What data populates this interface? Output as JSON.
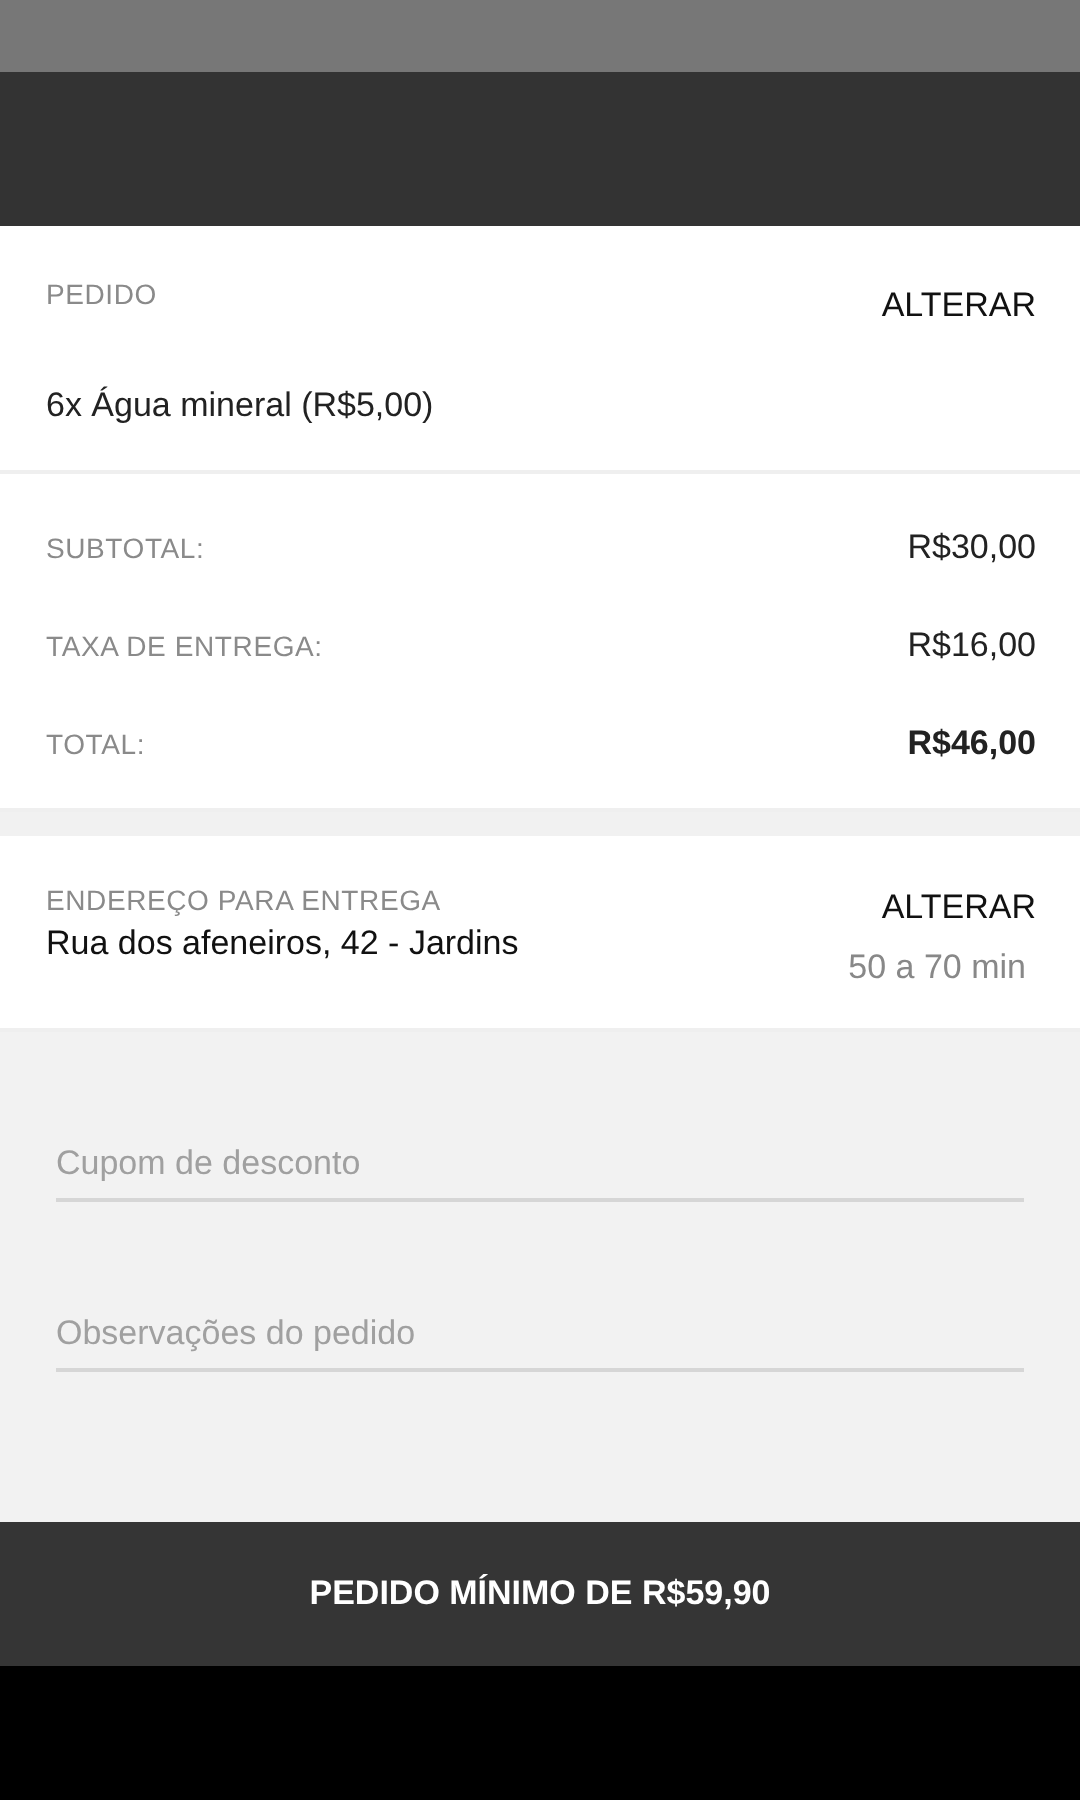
{
  "order": {
    "title": "PEDIDO",
    "action": "ALTERAR",
    "items": [
      "6x Água mineral (R$5,00)"
    ]
  },
  "totals": [
    {
      "label": "SUBTOTAL:",
      "value": "R$30,00",
      "emphasis": false
    },
    {
      "label": "TAXA DE ENTREGA:",
      "value": "R$16,00",
      "emphasis": false
    },
    {
      "label": "TOTAL:",
      "value": "R$46,00",
      "emphasis": true
    }
  ],
  "delivery": {
    "title": "ENDEREÇO PARA ENTREGA",
    "address": "Rua dos afeneiros, 42 - Jardins",
    "action": "ALTERAR",
    "time": "50 a 70 min"
  },
  "fields": [
    {
      "placeholder": "Cupom de desconto"
    },
    {
      "placeholder": "Observações do pedido"
    }
  ],
  "submit_button": "PEDIDO MÍNIMO DE R$59,90"
}
